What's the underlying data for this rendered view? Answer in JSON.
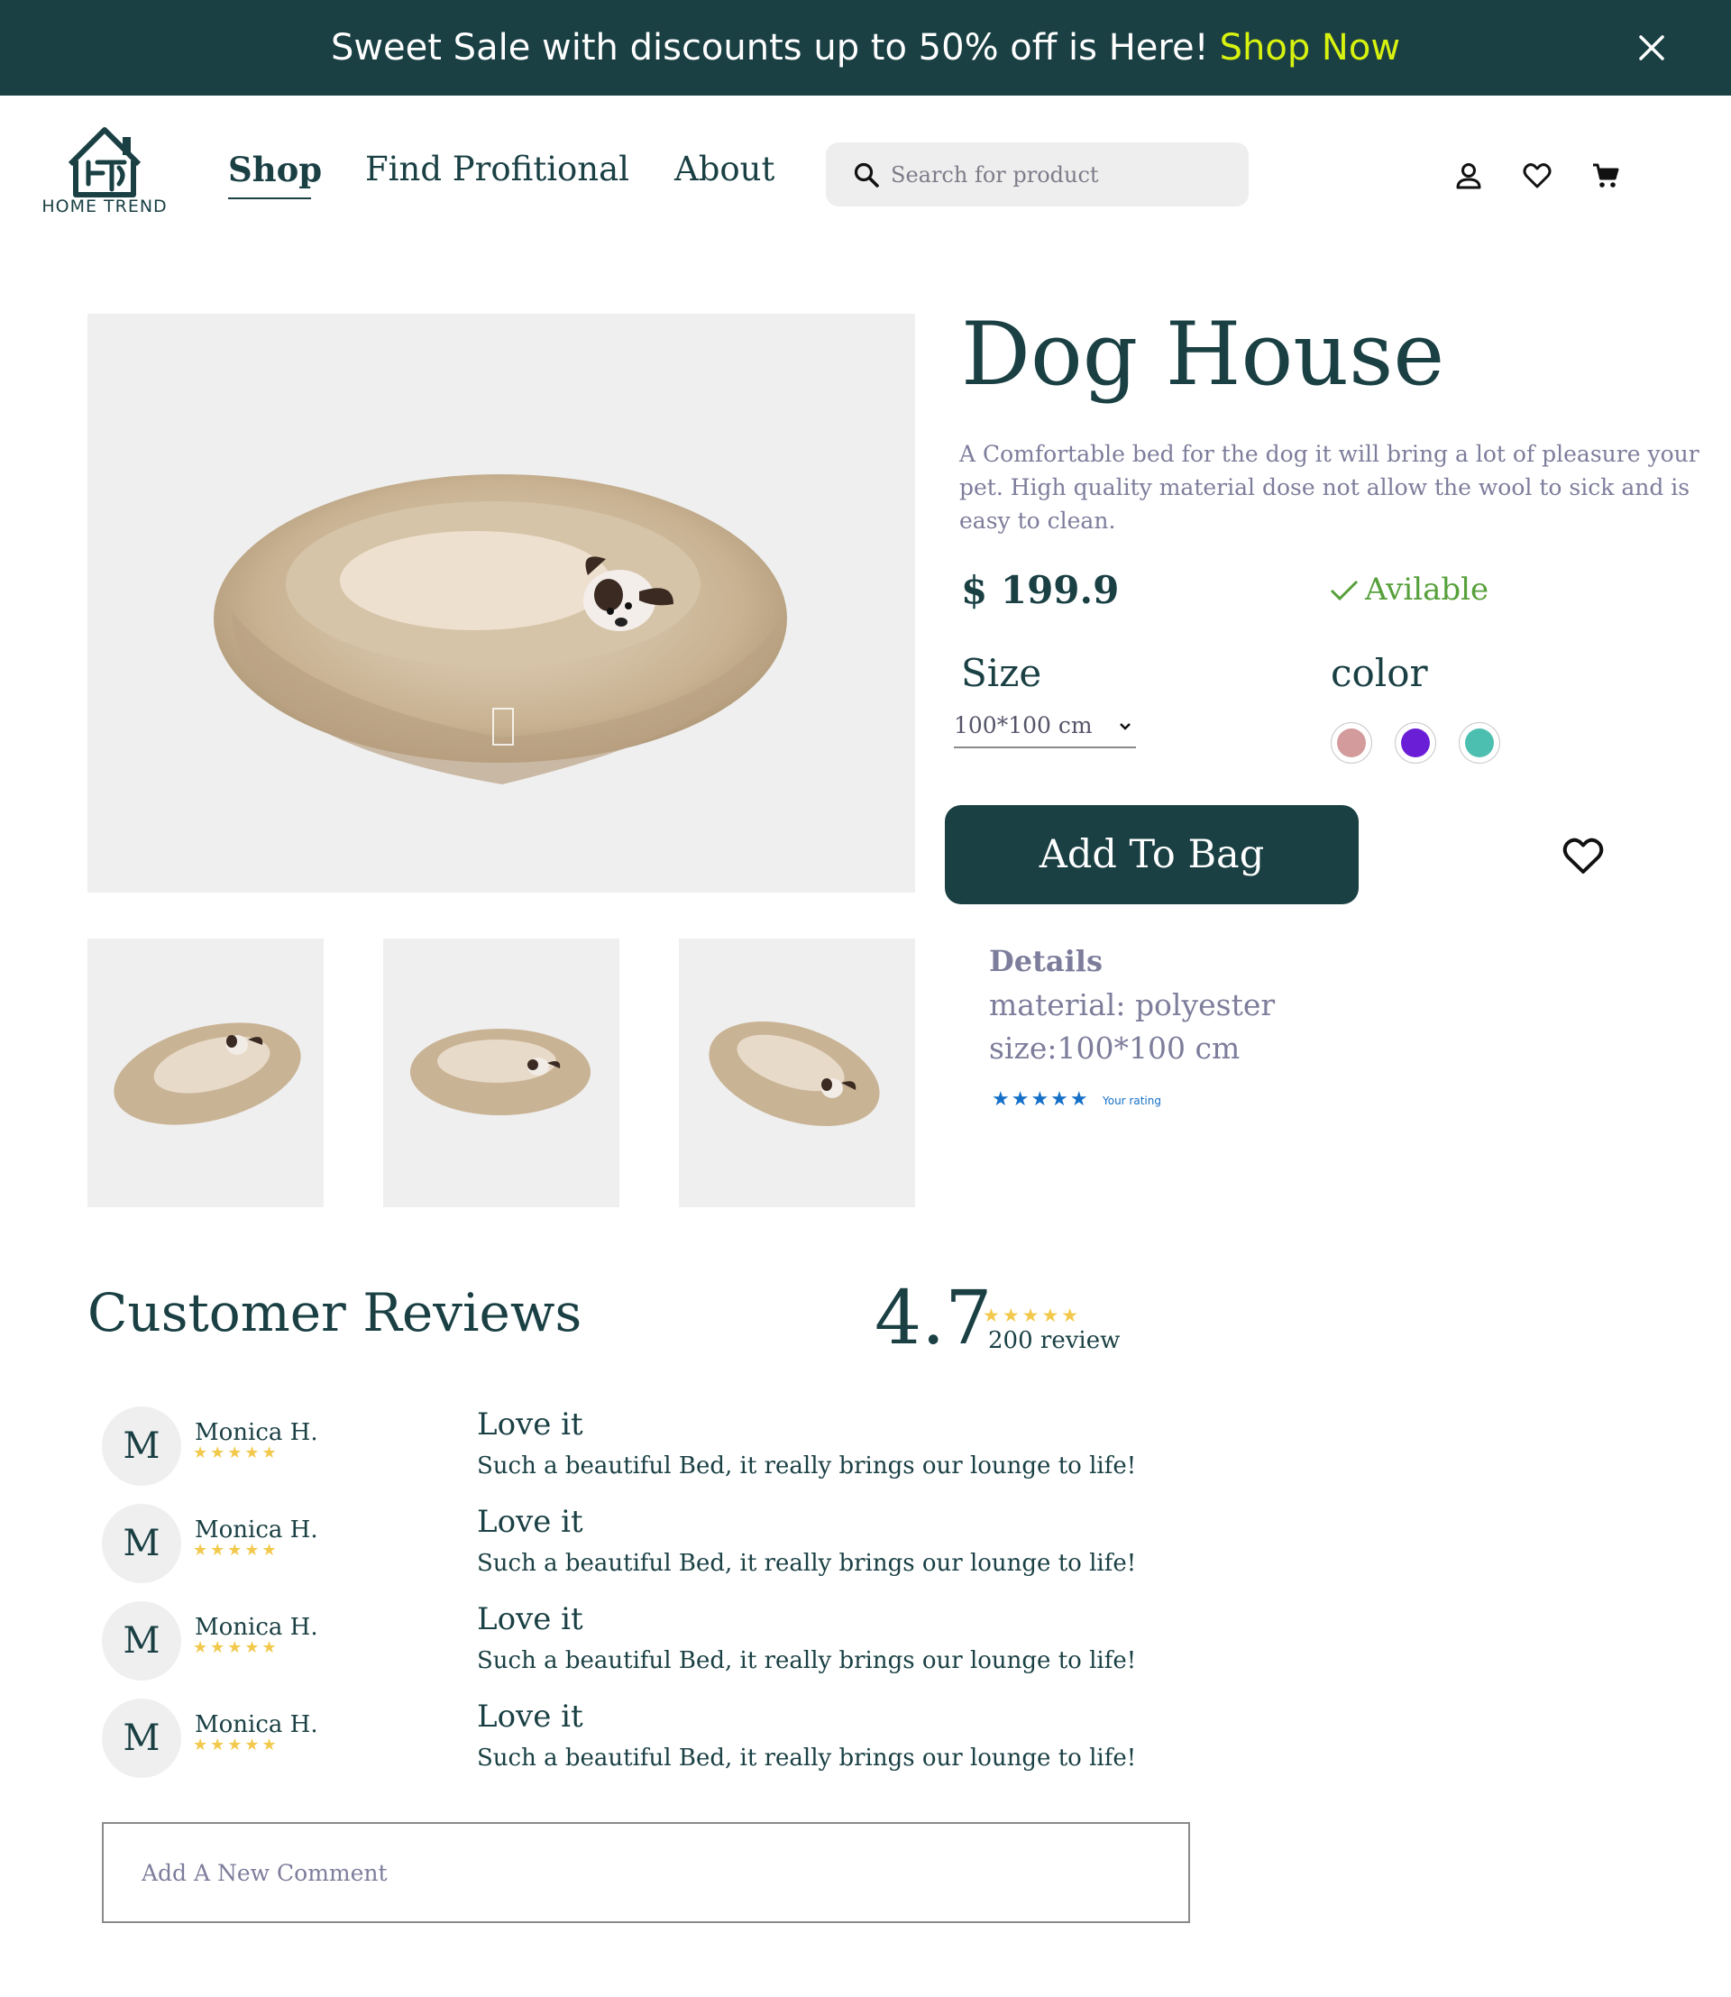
{
  "banner": {
    "text": "Sweet Sale with discounts up to 50% off is Here!",
    "cta": "Shop Now",
    "close_icon": "close-icon"
  },
  "header": {
    "logo_text": "HOME TREND",
    "nav": [
      {
        "label": "Shop",
        "active": true
      },
      {
        "label": "Find Profitional",
        "active": false
      },
      {
        "label": "About",
        "active": false
      }
    ],
    "search": {
      "placeholder": "Search for product",
      "icon": "search-icon"
    },
    "icons": [
      "user-icon",
      "heart-icon",
      "cart-icon"
    ]
  },
  "product": {
    "title": "Dog House",
    "description": "A Comfortable bed for the dog it will bring a lot of pleasure your pet. High quality material dose not allow the wool to sick and is easy to clean.",
    "price": "$ 199.9",
    "availability": "Avilable",
    "size_label": "Size",
    "size_value": "100*100 cm",
    "color_label": "color",
    "colors": [
      "#d39b9b",
      "#6a1fd6",
      "#4dbfb0"
    ],
    "add_to_bag": "Add To Bag",
    "details": {
      "title": "Details",
      "material_label": "material:",
      "material_value": "polyester",
      "size": "size:100*100 cm",
      "rating_label": "Your rating",
      "rating": 5
    }
  },
  "reviews": {
    "title": "Customer Reviews",
    "average": "4.7",
    "count_text": "200 review",
    "stars": 5,
    "items": [
      {
        "initial": "M",
        "name": "Monica H.",
        "stars": 5,
        "title": "Love it",
        "body": "Such a beautiful Bed, it really brings our lounge to life!"
      },
      {
        "initial": "M",
        "name": "Monica H.",
        "stars": 5,
        "title": "Love it",
        "body": "Such a beautiful Bed, it really brings our lounge to life!"
      },
      {
        "initial": "M",
        "name": "Monica H.",
        "stars": 5,
        "title": "Love it",
        "body": "Such a beautiful Bed, it really brings our lounge to life!"
      },
      {
        "initial": "M",
        "name": "Monica H.",
        "stars": 5,
        "title": "Love it",
        "body": "Such a beautiful Bed, it really brings our lounge to life!"
      }
    ],
    "comment_placeholder": "Add A New Comment"
  },
  "theme": {
    "primary": "#1a4044",
    "accent": "#d8f20f",
    "muted_text": "#7d7d9c",
    "available": "#56a03a",
    "star": "#f2c94c",
    "rating_blue": "#1670c8"
  }
}
